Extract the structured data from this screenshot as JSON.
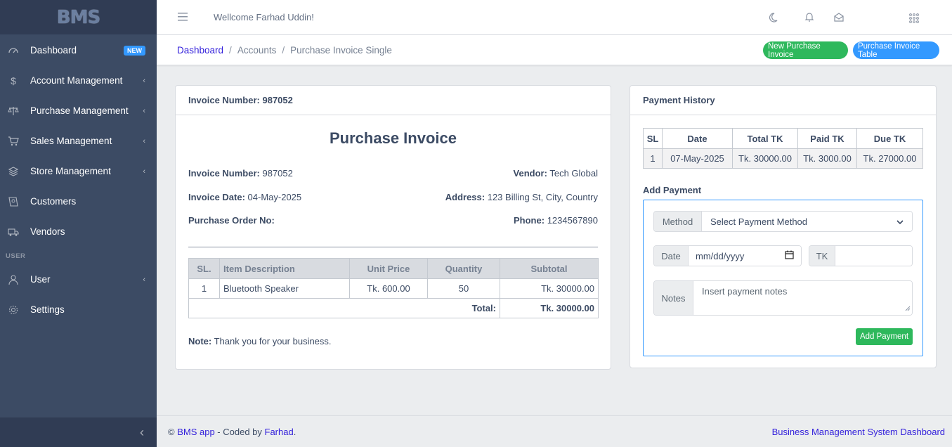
{
  "brand": {
    "logo_text": "BMS"
  },
  "sidebar": {
    "items": [
      {
        "label": "Dashboard",
        "icon": "speedometer-icon",
        "badge": "NEW"
      },
      {
        "label": "Account Management",
        "icon": "dollar-icon",
        "caret": "‹"
      },
      {
        "label": "Purchase Management",
        "icon": "balance-scale-icon",
        "caret": "‹"
      },
      {
        "label": "Sales Management",
        "icon": "cart-icon",
        "caret": "‹"
      },
      {
        "label": "Store Management",
        "icon": "layers-icon",
        "caret": "‹"
      },
      {
        "label": "Customers",
        "icon": "address-book-icon"
      },
      {
        "label": "Vendors",
        "icon": "truck-icon"
      }
    ],
    "section_title": "USER",
    "user_items": [
      {
        "label": "User",
        "icon": "user-icon",
        "caret": "‹"
      },
      {
        "label": "Settings",
        "icon": "gear-icon"
      }
    ],
    "toggler": "‹"
  },
  "header": {
    "welcome": "Wellcome Farhad Uddin!"
  },
  "breadcrumb": {
    "items": [
      "Dashboard",
      "Accounts",
      "Purchase Invoice Single"
    ],
    "sep": "/"
  },
  "actions": {
    "new_invoice": "New Purchase Invoice",
    "invoice_table": "Purchase Invoice Table"
  },
  "invoice": {
    "header_label": "Invoice Number:",
    "header_number": "987052",
    "title": "Purchase Invoice",
    "number_label": "Invoice Number:",
    "number": "987052",
    "vendor_label": "Vendor:",
    "vendor": "Tech Global",
    "date_label": "Invoice Date:",
    "date": "04-May-2025",
    "address_label": "Address:",
    "address": "123 Billing St, City, Country",
    "po_label": "Purchase Order No:",
    "po": "",
    "phone_label": "Phone:",
    "phone": "1234567890",
    "columns": [
      "SL.",
      "Item Description",
      "Unit Price",
      "Quantity",
      "Subtotal"
    ],
    "rows": [
      {
        "sl": "1",
        "description": "Bluetooth Speaker",
        "unit_price": "Tk. 600.00",
        "quantity": "50",
        "subtotal": "Tk. 30000.00"
      }
    ],
    "total_label": "Total:",
    "total": "Tk. 30000.00",
    "note_label": "Note:",
    "note": "Thank you for your business."
  },
  "payment": {
    "title": "Payment History",
    "columns": [
      "SL",
      "Date",
      "Total TK",
      "Paid TK",
      "Due TK"
    ],
    "rows": [
      {
        "sl": "1",
        "date": "07-May-2025",
        "total": "Tk. 30000.00",
        "paid": "Tk. 3000.00",
        "due": "Tk. 27000.00"
      }
    ],
    "add_title": "Add Payment",
    "method_label": "Method",
    "method_value": "Select Payment Method",
    "date_label": "Date",
    "date_placeholder": "mm/dd/yyyy",
    "tk_label": "TK",
    "tk_value": "",
    "notes_label": "Notes",
    "notes_placeholder": "Insert payment notes",
    "submit": "Add Payment"
  },
  "footer": {
    "copyright": "©",
    "app_link": "BMS app",
    "coded_by": " - Coded by ",
    "author": "Farhad",
    "period": ".",
    "right_link": "Business Management System Dashboard"
  },
  "colors": {
    "sidebar_bg": "#3c4b64",
    "primary": "#321fdb",
    "success": "#2eb85c",
    "info": "#3399ff"
  }
}
